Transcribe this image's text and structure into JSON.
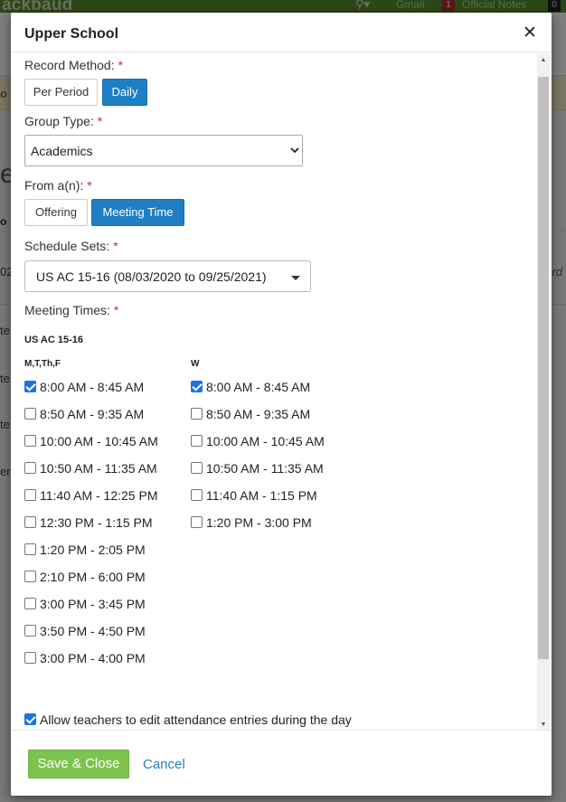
{
  "background": {
    "logo": "ackbaud",
    "top_links": {
      "gmail": "Gmail",
      "notes_count": "1",
      "official_notes": "Official Notes",
      "count": "0"
    },
    "banner_text": "o",
    "heading": "e",
    "tab": "o",
    "right_text": "rd",
    "rows": [
      "02",
      "te",
      "te",
      "te",
      "er"
    ]
  },
  "modal": {
    "title": "Upper School",
    "record_method": {
      "label": "Record Method:",
      "options": [
        "Per Period",
        "Daily"
      ]
    },
    "group_type": {
      "label": "Group Type:",
      "value": "Academics"
    },
    "from": {
      "label": "From a(n):",
      "options": [
        "Offering",
        "Meeting Time"
      ]
    },
    "schedule_sets": {
      "label": "Schedule Sets:",
      "value": "US AC 15-16 (08/03/2020 to 09/25/2021)"
    },
    "meeting_times": {
      "label": "Meeting Times:",
      "set_name": "US AC 15-16",
      "columns": [
        {
          "day": "M,T,Th,F",
          "times": [
            {
              "label": "8:00 AM - 8:45 AM",
              "checked": true
            },
            {
              "label": "8:50 AM - 9:35 AM",
              "checked": false
            },
            {
              "label": "10:00 AM - 10:45 AM",
              "checked": false
            },
            {
              "label": "10:50 AM - 11:35 AM",
              "checked": false
            },
            {
              "label": "11:40 AM - 12:25 PM",
              "checked": false
            },
            {
              "label": "12:30 PM - 1:15 PM",
              "checked": false
            },
            {
              "label": "1:20 PM - 2:05 PM",
              "checked": false
            },
            {
              "label": "2:10 PM - 6:00 PM",
              "checked": false
            },
            {
              "label": "3:00 PM - 3:45 PM",
              "checked": false
            },
            {
              "label": "3:50 PM - 4:50 PM",
              "checked": false
            },
            {
              "label": "3:00 PM - 4:00 PM",
              "checked": false
            }
          ]
        },
        {
          "day": "W",
          "times": [
            {
              "label": "8:00 AM - 8:45 AM",
              "checked": true
            },
            {
              "label": "8:50 AM - 9:35 AM",
              "checked": false
            },
            {
              "label": "10:00 AM - 10:45 AM",
              "checked": false
            },
            {
              "label": "10:50 AM - 11:35 AM",
              "checked": false
            },
            {
              "label": "11:40 AM - 1:15 PM",
              "checked": false
            },
            {
              "label": "1:20 PM - 3:00 PM",
              "checked": false
            }
          ]
        }
      ]
    },
    "allow_edit": {
      "label": "Allow teachers to edit attendance entries during the day",
      "checked": true
    },
    "footer": {
      "save": "Save & Close",
      "cancel": "Cancel"
    }
  },
  "colors": {
    "accent": "#1f7fc4",
    "save": "#7dc44e",
    "link": "#2a7fbf",
    "required": "#cc2b2b",
    "brand_bar": "#5a8f2e"
  }
}
